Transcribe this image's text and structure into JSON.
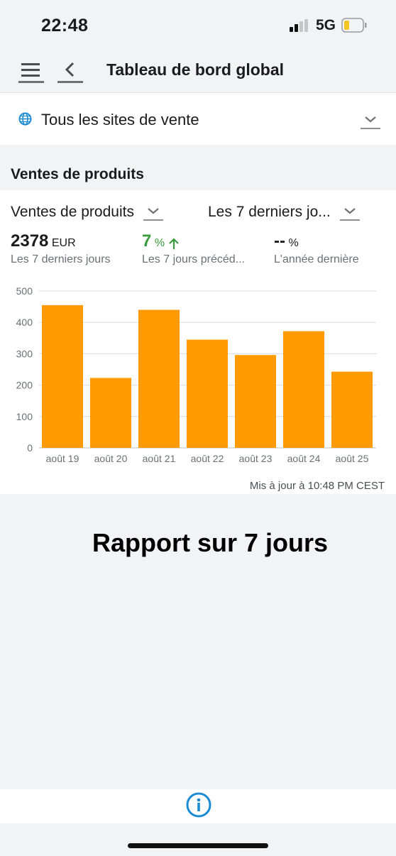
{
  "status_bar": {
    "time": "22:48",
    "network": "5G",
    "icons": [
      "signal-icon",
      "battery-icon"
    ]
  },
  "header": {
    "title": "Tableau de bord global",
    "icons": [
      "menu-icon",
      "back-icon"
    ]
  },
  "site_selector": {
    "label": "Tous les sites de vente",
    "icon": "globe-icon"
  },
  "section": {
    "title": "Ventes de produits"
  },
  "filters": {
    "metric": "Ventes de produits",
    "period": "Les 7 derniers jo..."
  },
  "stats": {
    "current": {
      "value": "2378",
      "unit": "EUR",
      "label": "Les 7 derniers jours"
    },
    "previous": {
      "value": "7",
      "unit": "%",
      "label": "Les 7 jours précéd..."
    },
    "last_year": {
      "value": "--",
      "unit": "%",
      "label": "L'année dernière"
    }
  },
  "colors": {
    "bar": "#ff9b00",
    "positive": "#3a9a3e",
    "accent": "#1a8ad4"
  },
  "chart_data": {
    "type": "bar",
    "categories": [
      "août 19",
      "août 20",
      "août 21",
      "août 22",
      "août 23",
      "août 24",
      "août 25"
    ],
    "values": [
      455,
      223,
      440,
      345,
      296,
      372,
      243
    ],
    "yticks": [
      0,
      100,
      200,
      300,
      400,
      500
    ],
    "ylim": [
      0,
      500
    ],
    "grid": true,
    "title": "",
    "xlabel": "",
    "ylabel": ""
  },
  "updated": "Mis à jour à 10:48 PM CEST",
  "report": {
    "title": "Rapport sur 7 jours"
  },
  "bottom_bar": {
    "icon": "info-icon"
  }
}
